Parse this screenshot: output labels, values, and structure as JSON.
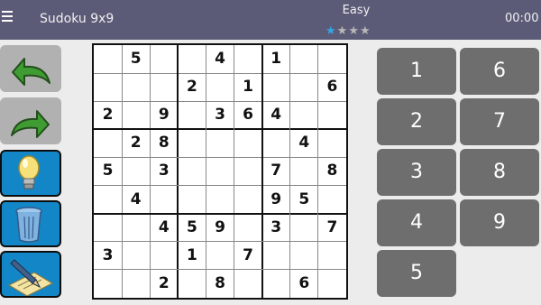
{
  "header": {
    "menu_icon": "hamburger-menu-icon",
    "title": "Sudoku 9x9",
    "difficulty": "Easy",
    "stars_filled": 1,
    "stars_total": 4,
    "timer": "00:00"
  },
  "toolbar": {
    "buttons": [
      {
        "name": "undo-button",
        "icon": "undo-arrow-icon"
      },
      {
        "name": "redo-button",
        "icon": "redo-arrow-icon"
      },
      {
        "name": "hint-button",
        "icon": "lightbulb-icon"
      },
      {
        "name": "clear-button",
        "icon": "trash-icon"
      },
      {
        "name": "notes-button",
        "icon": "pencil-notepad-icon"
      }
    ]
  },
  "board": {
    "rows": [
      [
        "",
        "5",
        "",
        "",
        "4",
        "",
        "1",
        "",
        ""
      ],
      [
        "",
        "",
        "",
        "2",
        "",
        "1",
        "",
        "",
        "6"
      ],
      [
        "2",
        "",
        "9",
        "",
        "3",
        "6",
        "4",
        "",
        ""
      ],
      [
        "",
        "2",
        "8",
        "",
        "",
        "",
        "",
        "4",
        ""
      ],
      [
        "5",
        "",
        "3",
        "",
        "",
        "",
        "7",
        "",
        "8"
      ],
      [
        "",
        "4",
        "",
        "",
        "",
        "",
        "9",
        "5",
        ""
      ],
      [
        "",
        "",
        "4",
        "5",
        "9",
        "",
        "3",
        "",
        "7"
      ],
      [
        "3",
        "",
        "",
        "1",
        "",
        "7",
        "",
        "",
        ""
      ],
      [
        "",
        "",
        "2",
        "",
        "8",
        "",
        "",
        "6",
        ""
      ]
    ]
  },
  "keypad": {
    "keys": [
      "1",
      "6",
      "2",
      "7",
      "3",
      "8",
      "4",
      "9",
      "5"
    ]
  },
  "colors": {
    "header_bg": "#5b5b78",
    "star_active": "#36a7e5",
    "key_bg": "#6e6e6e",
    "tool_blue": "#1386c8"
  }
}
